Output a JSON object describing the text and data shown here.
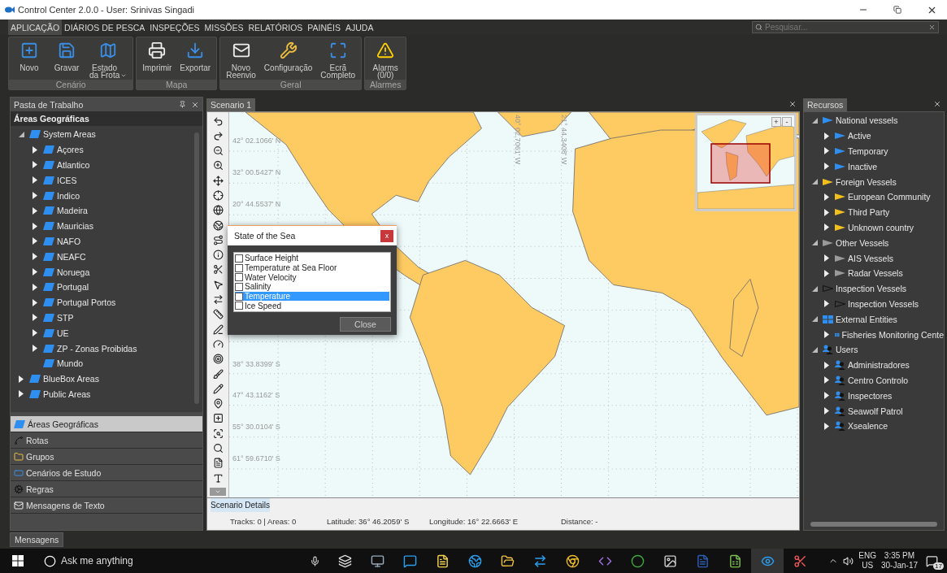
{
  "window": {
    "title": "Control Center 2.0.0 - User: Srinivas Singadi"
  },
  "menu": [
    {
      "label": "APLICAÇÃO",
      "selected": true
    },
    {
      "label": "DIÁRIOS DE PESCA",
      "selected": false
    },
    {
      "label": "INSPEÇÕES",
      "selected": false
    },
    {
      "label": "MISSÕES",
      "selected": false
    },
    {
      "label": "RELATÓRIOS",
      "selected": false
    },
    {
      "label": "PAINÉIS",
      "selected": false
    },
    {
      "label": "AJUDA",
      "selected": false
    }
  ],
  "search": {
    "placeholder": "Pesquisar..."
  },
  "ribbon": [
    {
      "label": "Cenário",
      "buttons": [
        {
          "label": "Novo"
        },
        {
          "label": "Gravar"
        },
        {
          "label": "Estado\nda Frota",
          "dropdown": true
        }
      ]
    },
    {
      "label": "Mapa",
      "buttons": [
        {
          "label": "Imprimir"
        },
        {
          "label": "Exportar"
        }
      ]
    },
    {
      "label": "Geral",
      "buttons": [
        {
          "label": "Novo\nReenvio"
        },
        {
          "label": "Configuração"
        },
        {
          "label": "Ecrã\nCompleto"
        }
      ]
    },
    {
      "label": "Alarmes",
      "buttons": [
        {
          "label": "Alarms\n(0/0)"
        }
      ]
    }
  ],
  "workbook": {
    "title": "Pasta de Trabalho",
    "section": "Áreas Geográficas",
    "tree": [
      {
        "label": "System Areas",
        "expanded": true,
        "children": [
          {
            "label": "Açores",
            "expanded": false
          },
          {
            "label": "Atlantico",
            "expanded": false
          },
          {
            "label": "ICES",
            "expanded": false
          },
          {
            "label": "Indico",
            "expanded": false
          },
          {
            "label": "Madeira",
            "expanded": false
          },
          {
            "label": "Mauricias",
            "expanded": false
          },
          {
            "label": "NAFO",
            "expanded": false
          },
          {
            "label": "NEAFC",
            "expanded": false
          },
          {
            "label": "Noruega",
            "expanded": false
          },
          {
            "label": "Portugal",
            "expanded": false
          },
          {
            "label": "Portugal Portos",
            "expanded": false
          },
          {
            "label": "STP",
            "expanded": false
          },
          {
            "label": "UE",
            "expanded": false
          },
          {
            "label": "ZP - Zonas Proibidas",
            "expanded": false
          },
          {
            "label": "Mundo"
          }
        ]
      },
      {
        "label": "BlueBox Areas",
        "expanded": false
      },
      {
        "label": "Public Areas",
        "expanded": false
      }
    ],
    "nav": [
      {
        "label": "Áreas Geográficas",
        "selected": true
      },
      {
        "label": "Rotas",
        "selected": false
      },
      {
        "label": "Grupos",
        "selected": false
      },
      {
        "label": "Cenários de Estudo",
        "selected": false
      },
      {
        "label": "Regras",
        "selected": false
      },
      {
        "label": "Mensagens de Texto",
        "selected": false
      }
    ]
  },
  "scenario": {
    "tab": "Scenario 1",
    "lat_labels": [
      "42° 02.1066' N",
      "32° 00.5427' N",
      "20° 44.5537' N",
      "38° 33.8399' S",
      "47° 43.1162' S",
      "55° 30.0104' S",
      "61° 59.6710' S"
    ],
    "lon_labels": [
      "40° 02.7061' W",
      "21° 44.3408' W"
    ],
    "minimap": {
      "zoom_in": "+",
      "zoom_out": "-"
    },
    "dialog": {
      "title": "State of the Sea",
      "close": "x",
      "button": "Close",
      "items": [
        {
          "label": "Surface Height",
          "checked": false,
          "selected": false
        },
        {
          "label": "Temperature at Sea Floor",
          "checked": false,
          "selected": false
        },
        {
          "label": "Water Velocity",
          "checked": false,
          "selected": false
        },
        {
          "label": "Salinity",
          "checked": false,
          "selected": false
        },
        {
          "label": "Temperature",
          "checked": false,
          "selected": true
        },
        {
          "label": "Ice Speed",
          "checked": false,
          "selected": false
        }
      ]
    },
    "details_tab": "Scenario Details",
    "status": [
      "Tracks: 0  |  Areas: 0",
      "Latitude:  36° 46.2059' S",
      "Longitude:  16° 22.6663' E",
      "Distance: -"
    ]
  },
  "resources": {
    "title": "Recursos",
    "tree": [
      {
        "label": "National vessels",
        "kind": "flag",
        "color": "#2f8ff0",
        "expanded": true,
        "children": [
          {
            "label": "Active",
            "kind": "flag",
            "color": "#2f8ff0",
            "expanded": false
          },
          {
            "label": "Temporary",
            "kind": "flag",
            "color": "#2f8ff0",
            "expanded": false
          },
          {
            "label": "Inactive",
            "kind": "flag",
            "color": "#2f8ff0",
            "expanded": false
          }
        ]
      },
      {
        "label": "Foreign Vessels",
        "kind": "flag",
        "color": "#f2c01e",
        "expanded": true,
        "children": [
          {
            "label": "European Community",
            "kind": "flag",
            "color": "#f2c01e",
            "expanded": false
          },
          {
            "label": "Third Party",
            "kind": "flag",
            "color": "#f2c01e",
            "expanded": false
          },
          {
            "label": "Unknown country",
            "kind": "flag",
            "color": "#f2c01e",
            "expanded": false
          }
        ]
      },
      {
        "label": "Other Vessels",
        "kind": "flag",
        "color": "#9a9a9a",
        "expanded": true,
        "children": [
          {
            "label": "AIS Vessels",
            "kind": "flag",
            "color": "#9a9a9a",
            "expanded": false
          },
          {
            "label": "Radar Vessels",
            "kind": "flag",
            "color": "#9a9a9a",
            "expanded": false
          }
        ]
      },
      {
        "label": "Inspection Vessels",
        "kind": "outline-flag",
        "expanded": true,
        "children": [
          {
            "label": "Inspection Vessels",
            "kind": "outline-flag",
            "expanded": false
          }
        ]
      },
      {
        "label": "External Entities",
        "kind": "grid",
        "expanded": true,
        "children": [
          {
            "label": "Fisheries Monitoring Cente",
            "kind": "grid",
            "expanded": false
          }
        ]
      },
      {
        "label": "Users",
        "kind": "users",
        "expanded": true,
        "children": [
          {
            "label": "Administradores",
            "kind": "users",
            "expanded": false
          },
          {
            "label": "Centro Controlo",
            "kind": "users",
            "expanded": false
          },
          {
            "label": "Inspectores",
            "kind": "users",
            "expanded": false
          },
          {
            "label": "Seawolf Patrol",
            "kind": "users",
            "expanded": false
          },
          {
            "label": "Xsealence",
            "kind": "users",
            "expanded": false
          }
        ]
      }
    ]
  },
  "messages_tab": "Mensagens",
  "taskbar": {
    "search_placeholder": "Ask me anything",
    "language": "ENG",
    "region": "US",
    "time": "3:35 PM",
    "date": "30-Jan-17",
    "notifications": "17"
  }
}
